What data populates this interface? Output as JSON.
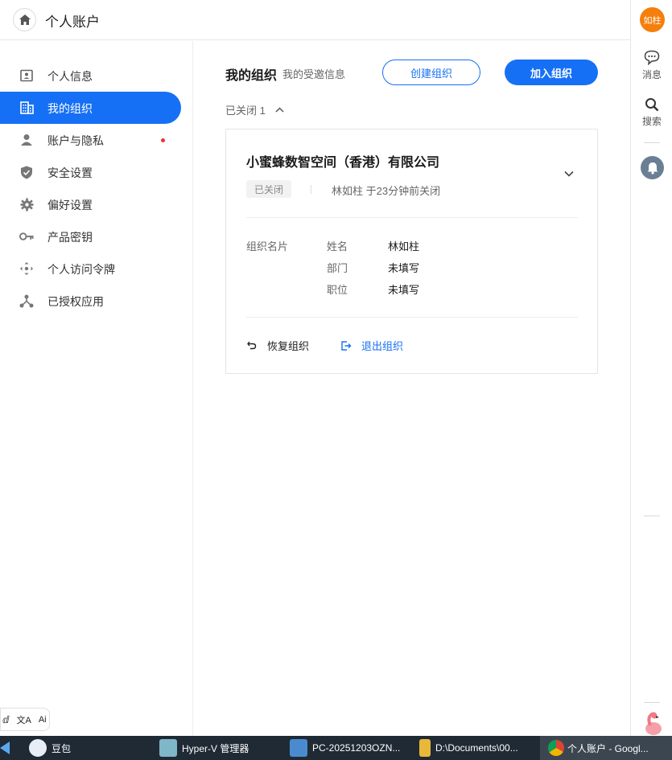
{
  "header": {
    "title": "个人账户"
  },
  "sidebar": {
    "items": [
      {
        "label": "个人信息",
        "icon": "id-card-icon"
      },
      {
        "label": "我的组织",
        "icon": "building-icon"
      },
      {
        "label": "账户与隐私",
        "icon": "person-icon"
      },
      {
        "label": "安全设置",
        "icon": "shield-icon"
      },
      {
        "label": "偏好设置",
        "icon": "gear-icon"
      },
      {
        "label": "产品密钥",
        "icon": "key-icon"
      },
      {
        "label": "个人访问令牌",
        "icon": "token-icon"
      },
      {
        "label": "已授权应用",
        "icon": "hierarchy-icon"
      }
    ],
    "active_index": 1
  },
  "main": {
    "title": "我的组织",
    "subtitle": "我的受邀信息",
    "create_button": "创建组织",
    "join_button": "加入组织",
    "closed_label": "已关闭 1",
    "org": {
      "name": "小蜜蜂数智空间（香港）有限公司",
      "status": "已关闭",
      "status_detail": "林如柱 于23分钟前关闭",
      "card_label": "组织名片",
      "fields": [
        {
          "label": "姓名",
          "value": "林如柱"
        },
        {
          "label": "部门",
          "value": "未填写"
        },
        {
          "label": "职位",
          "value": "未填写"
        }
      ],
      "restore_label": "恢复组织",
      "leave_label": "退出组织"
    }
  },
  "rail": {
    "avatar_text": "如柱",
    "messages_label": "消息",
    "search_label": "搜索"
  },
  "mini_tools": {
    "translate_label": "文A",
    "ai_label": "Ai"
  },
  "taskbar": {
    "items": [
      {
        "label": "豆包"
      },
      {
        "label": "Hyper-V 管理器"
      },
      {
        "label": "PC-20251203OZN..."
      },
      {
        "label": "D:\\Documents\\00..."
      },
      {
        "label": "个人账户 - Googl..."
      }
    ]
  },
  "colors": {
    "accent": "#1670f5",
    "avatar": "#f57f0c",
    "alert_dot": "#f0302c"
  }
}
